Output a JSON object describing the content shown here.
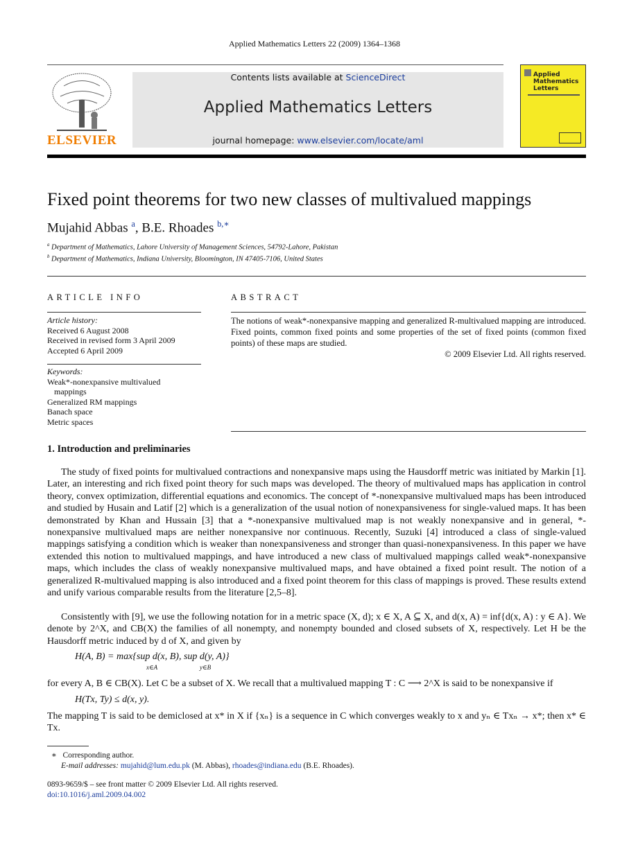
{
  "running_header": "Applied Mathematics Letters 22 (2009) 1364–1368",
  "publisher": "ELSEVIER",
  "banner": {
    "contents_prefix": "Contents lists available at ",
    "contents_link": "ScienceDirect",
    "journal": "Applied Mathematics Letters",
    "homepage_prefix": "journal homepage: ",
    "homepage_link": "www.elsevier.com/locate/aml"
  },
  "cover": {
    "title_lines": [
      "Applied",
      "Mathematics",
      "Letters"
    ],
    "color": "#f5ea25"
  },
  "title": "Fixed point theorems for two new classes of multivalued mappings",
  "authors": [
    {
      "name": "Mujahid Abbas",
      "mark": "a"
    },
    {
      "name": "B.E. Rhoades",
      "mark": "b,∗"
    }
  ],
  "affiliations": [
    {
      "mark": "a",
      "text": "Department of Mathematics, Lahore University of Management Sciences, 54792-Lahore, Pakistan"
    },
    {
      "mark": "b",
      "text": "Department of Mathematics, Indiana University, Bloomington, IN 47405-7106, United States"
    }
  ],
  "article_info": {
    "heading": "ARTICLE INFO",
    "history_label": "Article history:",
    "history": [
      "Received 6 August 2008",
      "Received in revised form 3 April 2009",
      "Accepted 6 April 2009"
    ],
    "keywords_label": "Keywords:",
    "keywords": [
      "Weak*-nonexpansive multivalued",
      "mappings",
      "Generalized RM mappings",
      "Banach space",
      "Metric spaces"
    ]
  },
  "abstract": {
    "heading": "ABSTRACT",
    "text": "The notions of weak*-nonexpansive mapping and generalized R-multivalued mapping are introduced. Fixed points, common fixed points and some properties of the set of fixed points (common fixed points) of these maps are studied.",
    "copyright": "© 2009 Elsevier Ltd. All rights reserved."
  },
  "section": {
    "heading": "1.  Introduction and preliminaries",
    "p1": "The study of fixed points for multivalued contractions and nonexpansive maps using the Hausdorff metric was initiated by Markin [1]. Later, an interesting and rich fixed point theory for such maps was developed. The theory of multivalued maps has application in control theory, convex optimization, differential equations and economics. The concept of *-nonexpansive multivalued maps has been introduced and studied by Husain and Latif [2] which is a generalization of the usual notion of nonexpansiveness for single-valued maps. It has been demonstrated by Khan and Hussain [3] that a *-nonexpansive multivalued map is not weakly nonexpansive and in general, *-nonexpansive multivalued maps are neither nonexpansive nor continuous. Recently, Suzuki [4] introduced a class of single-valued mappings satisfying a condition which is weaker than nonexpansiveness and stronger than quasi-nonexpansiveness. In this paper we have extended this notion to multivalued mappings, and have introduced a new class of multivalued mappings called weak*-nonexpansive maps, which includes the class of weakly nonexpansive multivalued maps, and have obtained a fixed point result. The notion of a generalized R-multivalued mapping is also introduced and a fixed point theorem for this class of mappings is proved. These results extend and unify various comparable results from the literature [2,5–8].",
    "p2": "Consistently with [9], we use the following notation for in a metric space (X, d); x ∈ X, A ⊆ X, and d(x, A) = inf{d(x, A) : y ∈ A}. We denote by 2^X, and CB(X) the families of all nonempty, and nonempty bounded and closed subsets of X, respectively. Let H be the Hausdorff metric induced by d of X, and given by",
    "eq1": "H(A, B) = max{sup d(x, B), sup d(y, A)}",
    "eq1_sub1": "x∈A",
    "eq1_sub2": "y∈B",
    "p3": "for every A, B ∈ CB(X). Let C be a subset of X. We recall that a multivalued mapping T : C ⟶ 2^X is said to be nonexpansive if",
    "eq2": "H(Tx, Ty) ≤ d(x, y).",
    "p4": "The mapping T is said to be demiclosed at x* in X if {xₙ} is a sequence in C which converges weakly to x and yₙ ∈ Txₙ → x*; then x* ∈ Tx."
  },
  "footnote": {
    "mark": "∗",
    "corresponding": "Corresponding author.",
    "email_label": "E-mail addresses:",
    "email1": "mujahid@lum.edu.pk",
    "name1": " (M. Abbas), ",
    "email2": "rhoades@indiana.edu",
    "name2": " (B.E. Rhoades)."
  },
  "issn": "0893-9659/$ – see front matter © 2009 Elsevier Ltd. All rights reserved.",
  "doi": "doi:10.1016/j.aml.2009.04.002"
}
